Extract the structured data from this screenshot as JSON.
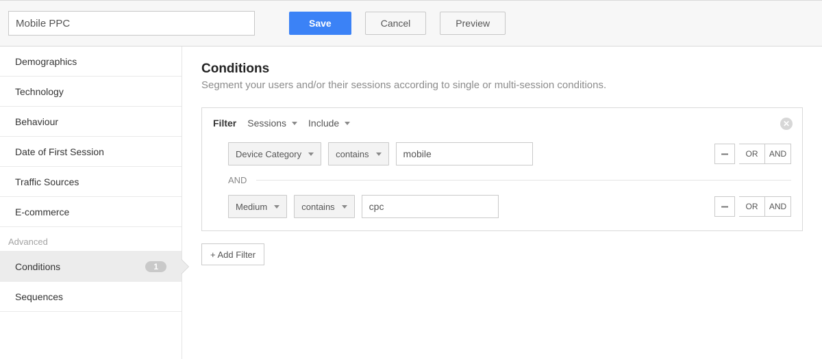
{
  "header": {
    "segment_name_value": "Mobile PPC",
    "save_label": "Save",
    "cancel_label": "Cancel",
    "preview_label": "Preview"
  },
  "sidebar": {
    "items": [
      {
        "label": "Demographics"
      },
      {
        "label": "Technology"
      },
      {
        "label": "Behaviour"
      },
      {
        "label": "Date of First Session"
      },
      {
        "label": "Traffic Sources"
      },
      {
        "label": "E-commerce"
      }
    ],
    "advanced_label": "Advanced",
    "advanced_items": [
      {
        "label": "Conditions",
        "badge": "1",
        "selected": true
      },
      {
        "label": "Sequences"
      }
    ]
  },
  "main": {
    "title": "Conditions",
    "subtitle": "Segment your users and/or their sessions according to single or multi-session conditions.",
    "filter": {
      "label": "Filter",
      "scope": "Sessions",
      "mode": "Include",
      "conditions": [
        {
          "dimension": "Device Category",
          "operator": "contains",
          "value": "mobile"
        },
        {
          "dimension": "Medium",
          "operator": "contains",
          "value": "cpc"
        }
      ],
      "joiner": "AND",
      "row_controls": {
        "minus": "–",
        "or": "OR",
        "and": "AND"
      }
    },
    "add_filter_label": "+ Add Filter"
  }
}
